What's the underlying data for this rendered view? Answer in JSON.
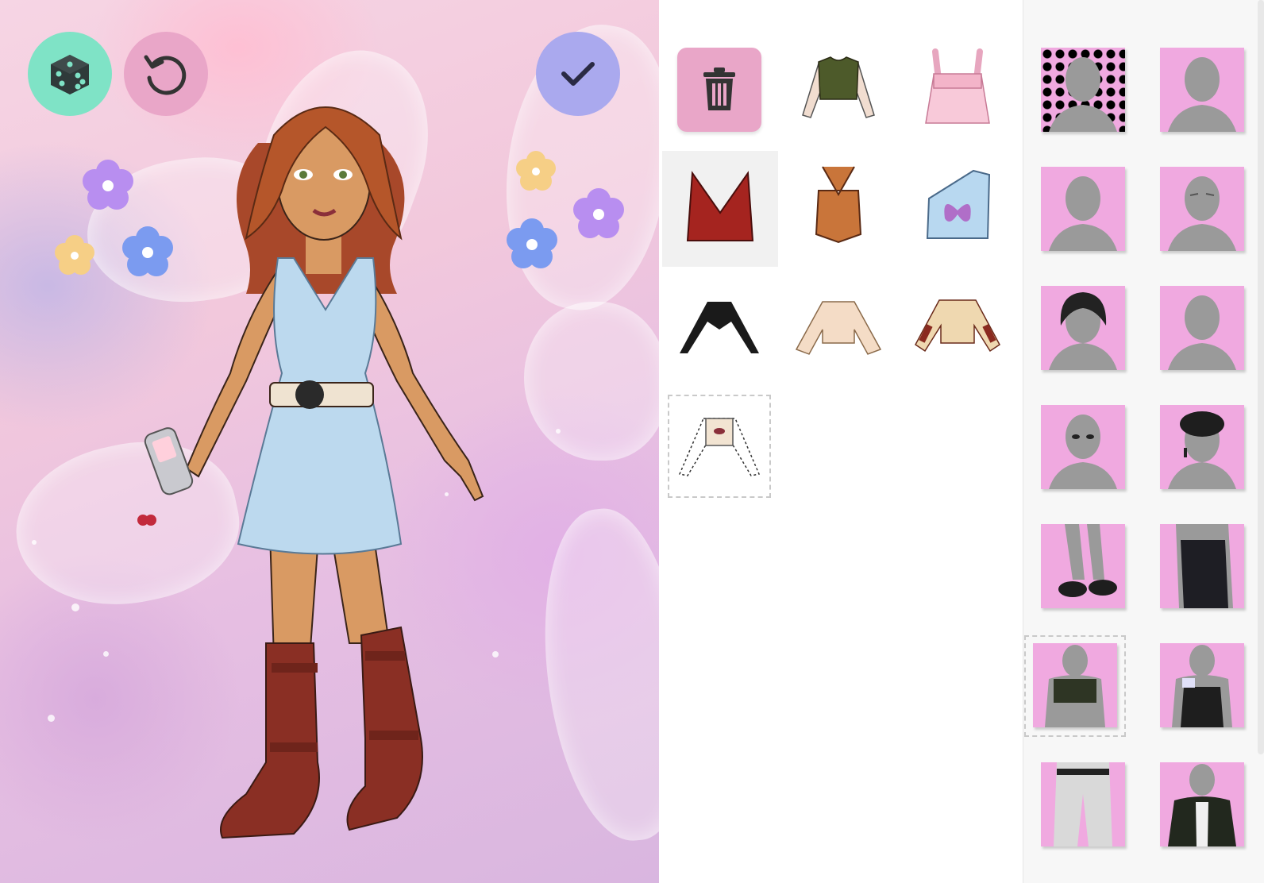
{
  "toolbar": {
    "randomize": {
      "icon": "dice-icon",
      "color": "#7fe3c6"
    },
    "reset": {
      "icon": "reset-icon",
      "color": "#e9a6c8"
    },
    "confirm": {
      "icon": "check-icon",
      "color": "#aaa9ee"
    }
  },
  "wardrobe": {
    "delete": {
      "icon": "trash-icon",
      "color": "#e9a6c8"
    },
    "items": [
      {
        "name": "olive-tee-sheer-sleeves",
        "selected": false
      },
      {
        "name": "pink-ruffle-cami",
        "selected": false
      },
      {
        "name": "red-halter-top",
        "selected": true
      },
      {
        "name": "brown-corset-halter",
        "selected": false
      },
      {
        "name": "blue-one-shoulder-butterfly-top",
        "selected": false
      },
      {
        "name": "black-shrug",
        "selected": false
      },
      {
        "name": "cream-peasant-blouse",
        "selected": false
      },
      {
        "name": "striped-sleeve-crop-top",
        "selected": false
      },
      {
        "name": "fishnet-sleeve-crop-top",
        "selected": false
      }
    ]
  },
  "categories": [
    {
      "name": "background",
      "selected": false
    },
    {
      "name": "body",
      "selected": false
    },
    {
      "name": "face",
      "selected": false
    },
    {
      "name": "eyes",
      "selected": false
    },
    {
      "name": "hair",
      "selected": false
    },
    {
      "name": "freckles",
      "selected": false
    },
    {
      "name": "eyes-makeup",
      "selected": false
    },
    {
      "name": "hats-earrings",
      "selected": false
    },
    {
      "name": "shoes",
      "selected": false
    },
    {
      "name": "bottoms",
      "selected": false
    },
    {
      "name": "tops",
      "selected": true
    },
    {
      "name": "dresses",
      "selected": false
    },
    {
      "name": "belts",
      "selected": false
    },
    {
      "name": "jackets",
      "selected": false
    }
  ],
  "colors": {
    "category_bg": "#f0a9e0",
    "mannequin": "#9a9a9a",
    "skin": "#d99a63",
    "hair": "#b5562a",
    "dress": "#bcd9ee",
    "boots": "#8a2f24"
  }
}
